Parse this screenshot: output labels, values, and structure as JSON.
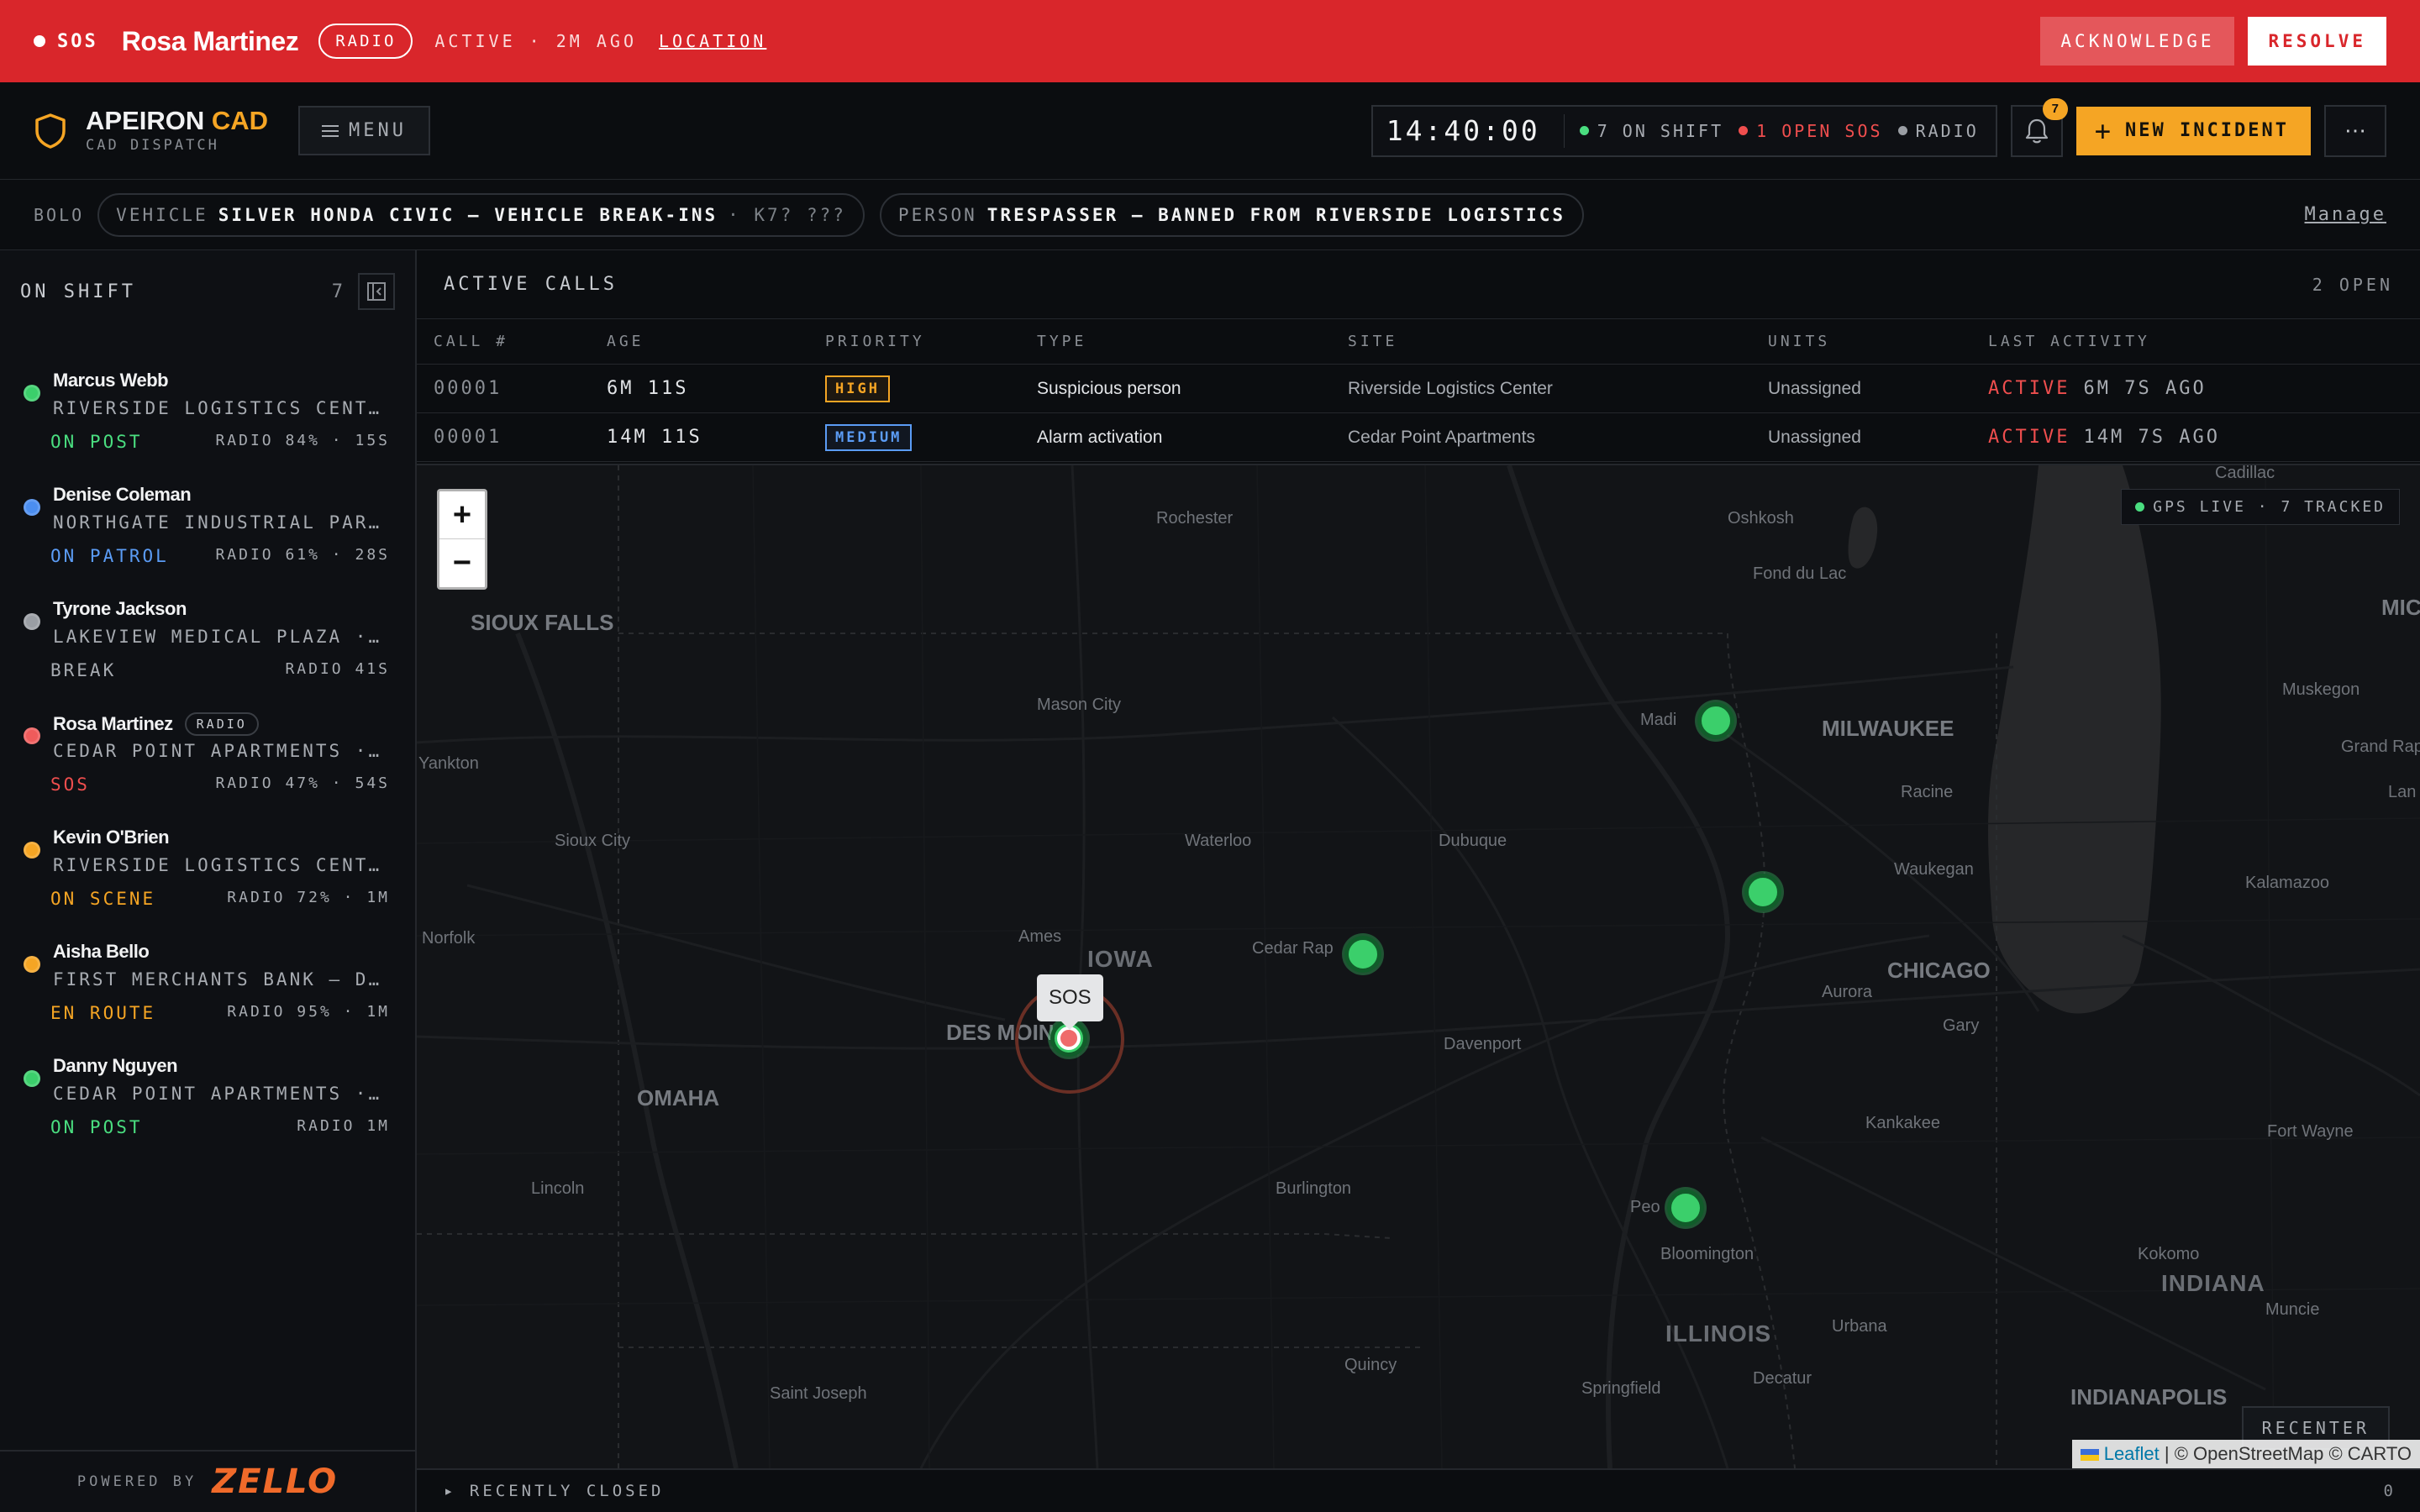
{
  "sos_banner": {
    "label": "SOS",
    "officer_name": "Rosa Martinez",
    "channel": "RADIO",
    "status": "ACTIVE · 2M AGO",
    "location_link": "LOCATION",
    "acknowledge_label": "ACKNOWLEDGE",
    "resolve_label": "RESOLVE",
    "color": "#d9262b"
  },
  "header": {
    "brand_name": "APEIRON",
    "brand_suffix": "CAD",
    "brand_sub": "CAD DISPATCH",
    "menu_label": "MENU",
    "clock": "14:40:00",
    "on_shift": "7 ON SHIFT",
    "open_sos": "1 OPEN SOS",
    "radio": "RADIO",
    "notifications_count": "7",
    "new_incident_label": "NEW INCIDENT",
    "more_icon": "more-horizontal-icon",
    "accent_color": "#f5a524"
  },
  "bolo": {
    "label": "BOLO",
    "items": [
      {
        "kind": "VEHICLE",
        "text": "SILVER HONDA CIVIC — VEHICLE BREAK-INS",
        "extra": "· K7? ???"
      },
      {
        "kind": "PERSON",
        "text": "TRESPASSER — BANNED FROM RIVERSIDE LOGISTICS",
        "extra": ""
      }
    ],
    "manage_label": "Manage"
  },
  "sidebar": {
    "title": "ON SHIFT",
    "count": "7",
    "officers": [
      {
        "name": "Marcus Webb",
        "tag": "",
        "site": "RIVERSIDE LOGISTICS CENTER…",
        "site_status": "",
        "state": "ON POST",
        "state_color": "#4ade80",
        "dot_color": "#3bcf6b",
        "meta": "RADIO 84% · 15S"
      },
      {
        "name": "Denise Coleman",
        "tag": "",
        "site": "NORTHGATE INDUSTRIAL PARK ·…",
        "site_status": "",
        "state": "ON PATROL",
        "state_color": "#5b9cf5",
        "dot_color": "#4b8ef0",
        "meta": "RADIO 61% · 28S"
      },
      {
        "name": "Tyrone Jackson",
        "tag": "",
        "site": "LAKEVIEW MEDICAL PLAZA · ",
        "site_status": "ON…",
        "state": "BREAK",
        "state_color": "#a7abb1",
        "dot_color": "#9a9ea4",
        "meta": "RADIO 41S"
      },
      {
        "name": "Rosa Martinez",
        "tag": "RADIO",
        "site": "CEDAR POINT APARTMENTS · ",
        "site_status": "ON…",
        "state": "SOS",
        "state_color": "#ef4e4e",
        "dot_color": "#ef5b5b",
        "meta": "RADIO 47% · 54S"
      },
      {
        "name": "Kevin O'Brien",
        "tag": "",
        "site": "RIVERSIDE LOGISTICS CENTER…",
        "site_status": "",
        "state": "ON SCENE",
        "state_color": "#f5a524",
        "dot_color": "#f5a524",
        "meta": "RADIO 72% · 1M"
      },
      {
        "name": "Aisha Bello",
        "tag": "",
        "site": "FIRST MERCHANTS BANK — DOW…",
        "site_status": "",
        "state": "EN ROUTE",
        "state_color": "#f5a524",
        "dot_color": "#f5a524",
        "meta": "RADIO 95% · 1M"
      },
      {
        "name": "Danny Nguyen",
        "tag": "",
        "site": "CEDAR POINT APARTMENTS · ",
        "site_status": "ON…",
        "state": "ON POST",
        "state_color": "#4ade80",
        "dot_color": "#3bcf6b",
        "meta": "RADIO 1M"
      }
    ],
    "powered_by": "POWERED BY",
    "powered_brand": "ZELLO"
  },
  "calls": {
    "title": "ACTIVE CALLS",
    "open_count": "2 OPEN",
    "columns": [
      "CALL #",
      "AGE",
      "PRIORITY",
      "TYPE",
      "SITE",
      "UNITS",
      "LAST ACTIVITY"
    ],
    "rows": [
      {
        "num": "00001",
        "age": "6M 11S",
        "priority": "HIGH",
        "priority_color": "#f5a524",
        "type": "Suspicious person",
        "site": "Riverside Logistics Center",
        "units": "Unassigned",
        "last_status": "ACTIVE",
        "last_time": "6M 7S AGO"
      },
      {
        "num": "00001",
        "age": "14M 11S",
        "priority": "MEDIUM",
        "priority_color": "#5b9cf5",
        "type": "Alarm activation",
        "site": "Cedar Point Apartments",
        "units": "Unassigned",
        "last_status": "ACTIVE",
        "last_time": "14M 7S AGO"
      }
    ]
  },
  "map": {
    "zoom_in": "+",
    "zoom_out": "−",
    "gps_status": "GPS LIVE · 7 TRACKED",
    "sos_popup": "SOS",
    "recenter_label": "RECENTER",
    "attribution_leaflet": "Leaflet",
    "attribution_rest": "| © OpenStreetMap © CARTO",
    "places": {
      "rochester": "Rochester",
      "oshkosh": "Oshkosh",
      "cadillac": "Cadillac",
      "fond_du_lac": "Fond du Lac",
      "sioux_falls": "SIOUX FALLS",
      "mic": "MIC",
      "muskegon": "Muskegon",
      "mason_city": "Mason City",
      "madison": "Madi",
      "milwaukee": "MILWAUKEE",
      "grand_rapids": "Grand Rapids",
      "yankton": "Yankton",
      "racine": "Racine",
      "lan": "Lan",
      "sioux_city": "Sioux City",
      "waterloo": "Waterloo",
      "dubuque": "Dubuque",
      "waukegan": "Waukegan",
      "kalamazoo": "Kalamazoo",
      "norfolk": "Norfolk",
      "ames": "Ames",
      "iowa": "IOWA",
      "cedar_rapids": "Cedar Rap",
      "chicago": "CHICAGO",
      "aurora": "Aurora",
      "des_moines": "DES MOIN",
      "gary": "Gary",
      "davenport": "Davenport",
      "omaha": "OMAHA",
      "kankakee": "Kankakee",
      "fort_wayne": "Fort Wayne",
      "lincoln": "Lincoln",
      "burlington": "Burlington",
      "peoria": "Peo",
      "bloomington": "Bloomington",
      "kokomo": "Kokomo",
      "indiana": "INDIANA",
      "muncie": "Muncie",
      "illinois": "ILLINOIS",
      "urbana": "Urbana",
      "quincy": "Quincy",
      "decatur": "Decatur",
      "saint_joseph": "Saint Joseph",
      "springfield": "Springfield",
      "indianapolis": "INDIANAPOLIS"
    }
  },
  "recently_closed": {
    "label": "▸ RECENTLY CLOSED",
    "count": "0"
  }
}
